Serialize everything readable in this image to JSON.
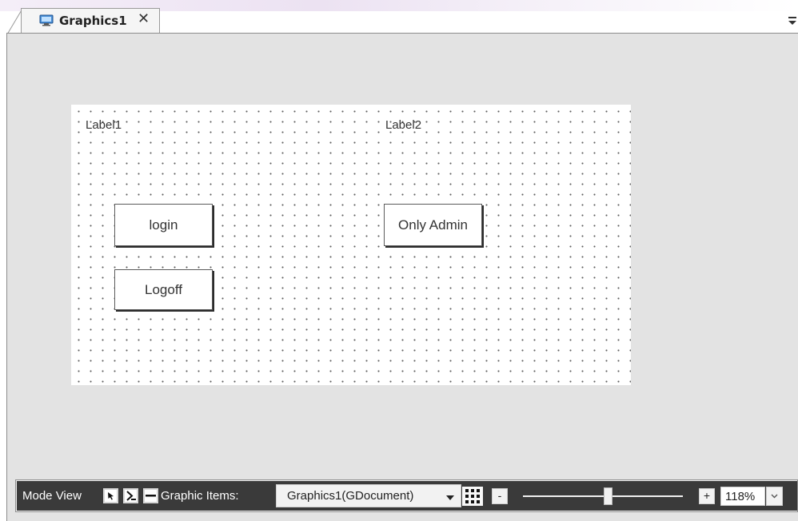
{
  "tab": {
    "title": "Graphics1",
    "close": "✕",
    "icon": "monitor-icon"
  },
  "canvas": {
    "labels": [
      "Label1",
      "Label2"
    ],
    "buttons": [
      "login",
      "Logoff",
      "Only Admin"
    ]
  },
  "statusbar": {
    "mode_view_label": "Mode View",
    "graphic_items_label": "Graphic Items:",
    "graphic_items_value": "Graphics1(GDocument)",
    "zoom_minus": "-",
    "zoom_plus": "+",
    "zoom_value": "118%",
    "zoom_slider_fraction": 0.53
  },
  "colors": {
    "canvas_bg": "#ffffff",
    "workspace_bg": "#e3e3e3",
    "statusbar_bg": "#3a3a3a"
  }
}
